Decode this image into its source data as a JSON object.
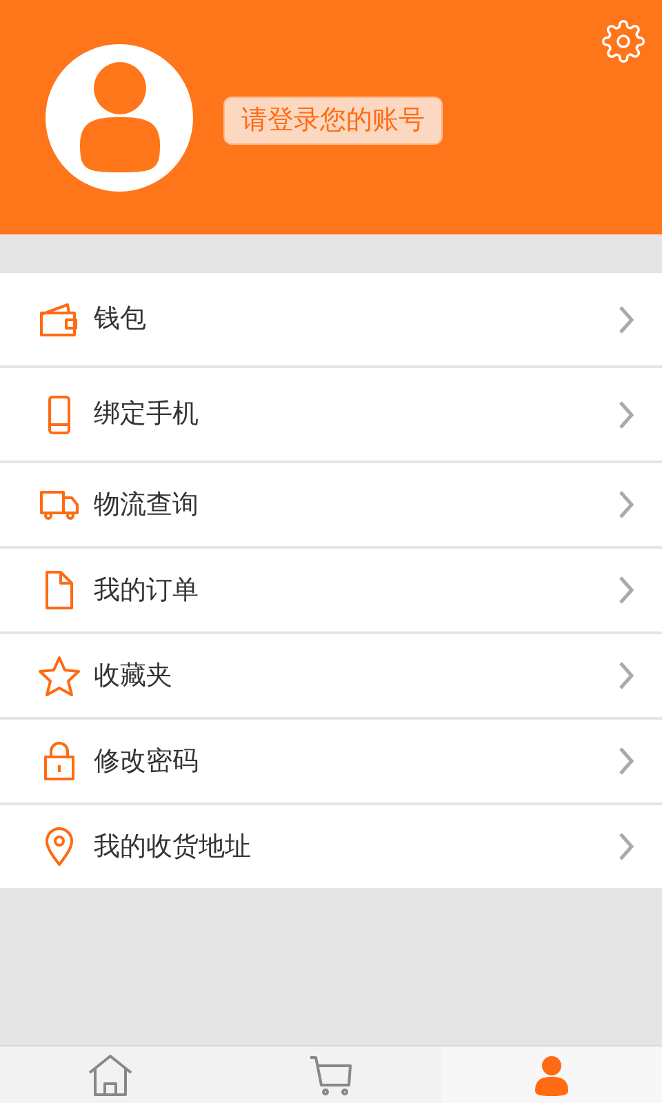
{
  "header": {
    "login_prompt": "请登录您的账号"
  },
  "menu": [
    {
      "kind": "wallet",
      "label": "钱包"
    },
    {
      "kind": "phone",
      "label": "绑定手机"
    },
    {
      "kind": "truck",
      "label": "物流查询"
    },
    {
      "kind": "document",
      "label": "我的订单"
    },
    {
      "kind": "star",
      "label": "收藏夹"
    },
    {
      "kind": "lock",
      "label": "修改密码"
    },
    {
      "kind": "pin",
      "label": "我的收货地址"
    }
  ],
  "tabs": [
    {
      "kind": "home",
      "selected": false
    },
    {
      "kind": "cart",
      "selected": false
    },
    {
      "kind": "user",
      "selected": true
    }
  ]
}
